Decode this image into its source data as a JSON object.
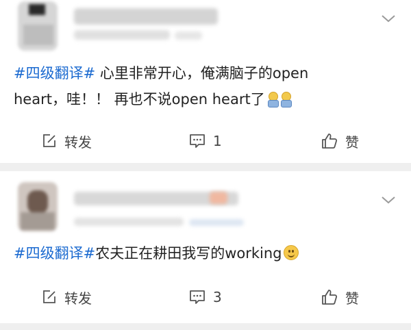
{
  "posts": [
    {
      "hashtag": "#四级翻译#",
      "line1_rest": " 心里非常开心，俺满脑子的open",
      "line2": "heart，哇！！ 再也不说open heart了",
      "repost_label": "转发",
      "comment_count": "1",
      "like_label": "赞",
      "emoji_names": [
        "tired-face-emoji",
        "tired-face-emoji"
      ]
    },
    {
      "hashtag": "#四级翻译#",
      "line1_rest": "农夫正在耕田我写的working",
      "repost_label": "转发",
      "comment_count": "3",
      "like_label": "赞",
      "emoji_names": [
        "smile-emoji"
      ]
    }
  ],
  "icons": {
    "repost": "edit-square-icon",
    "comment": "comment-bubble-icon",
    "like": "thumbs-up-icon",
    "menu": "chevron-down-icon"
  },
  "colors": {
    "hashtag": "#1b6ad0",
    "text": "#222222",
    "background": "#efefef",
    "card": "#ffffff"
  }
}
